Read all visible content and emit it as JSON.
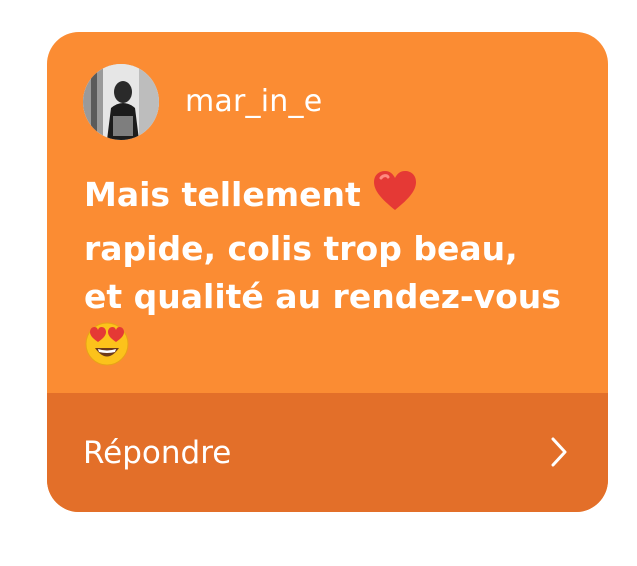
{
  "story_reply": {
    "username": "mar_in_e",
    "message_lines": [
      "Mais tellement",
      "rapide, colis trop beau,",
      "et qualité au rendez-vous"
    ],
    "emojis": [
      "heart-emoji",
      "heart-eyes-emoji"
    ],
    "reply_label": "Répondre"
  },
  "colors": {
    "card_background": "#fb8c33",
    "footer_background": "#e36f29",
    "text": "#ffffff"
  },
  "icons": [
    "avatar-photo",
    "heart-emoji",
    "heart-eyes-emoji",
    "chevron-right-icon"
  ]
}
